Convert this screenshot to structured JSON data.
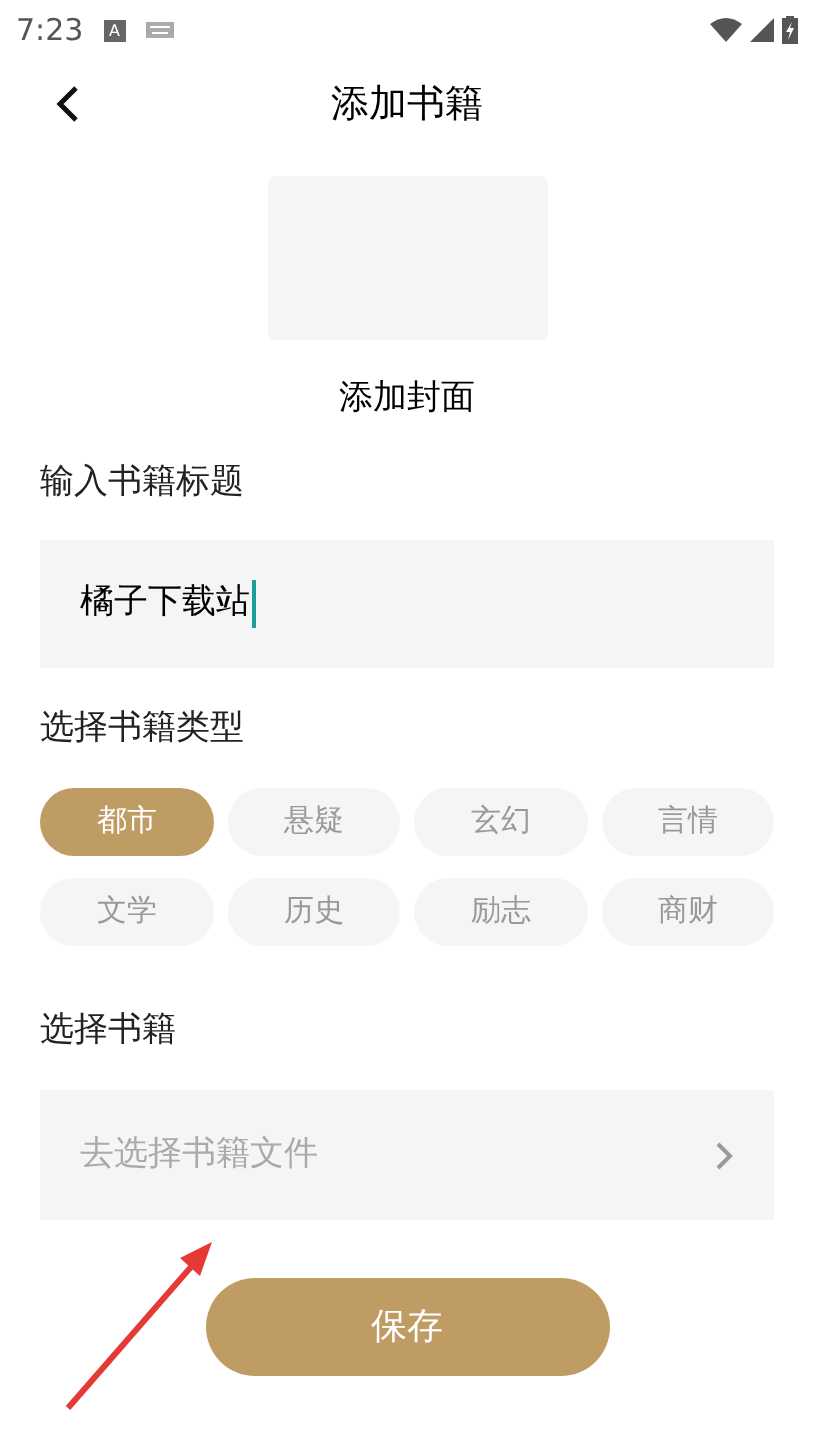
{
  "status_bar": {
    "time": "7:23",
    "notification_letter": "A"
  },
  "header": {
    "title": "添加书籍"
  },
  "cover": {
    "label": "添加封面"
  },
  "title_field": {
    "label": "输入书籍标题",
    "value": "橘子下载站"
  },
  "genres": {
    "label": "选择书籍类型",
    "items": [
      {
        "label": "都市",
        "selected": true
      },
      {
        "label": "悬疑",
        "selected": false
      },
      {
        "label": "玄幻",
        "selected": false
      },
      {
        "label": "言情",
        "selected": false
      },
      {
        "label": "文学",
        "selected": false
      },
      {
        "label": "历史",
        "selected": false
      },
      {
        "label": "励志",
        "selected": false
      },
      {
        "label": "商财",
        "selected": false
      }
    ]
  },
  "file_picker": {
    "label": "选择书籍",
    "placeholder": "去选择书籍文件"
  },
  "save_button": "保存"
}
